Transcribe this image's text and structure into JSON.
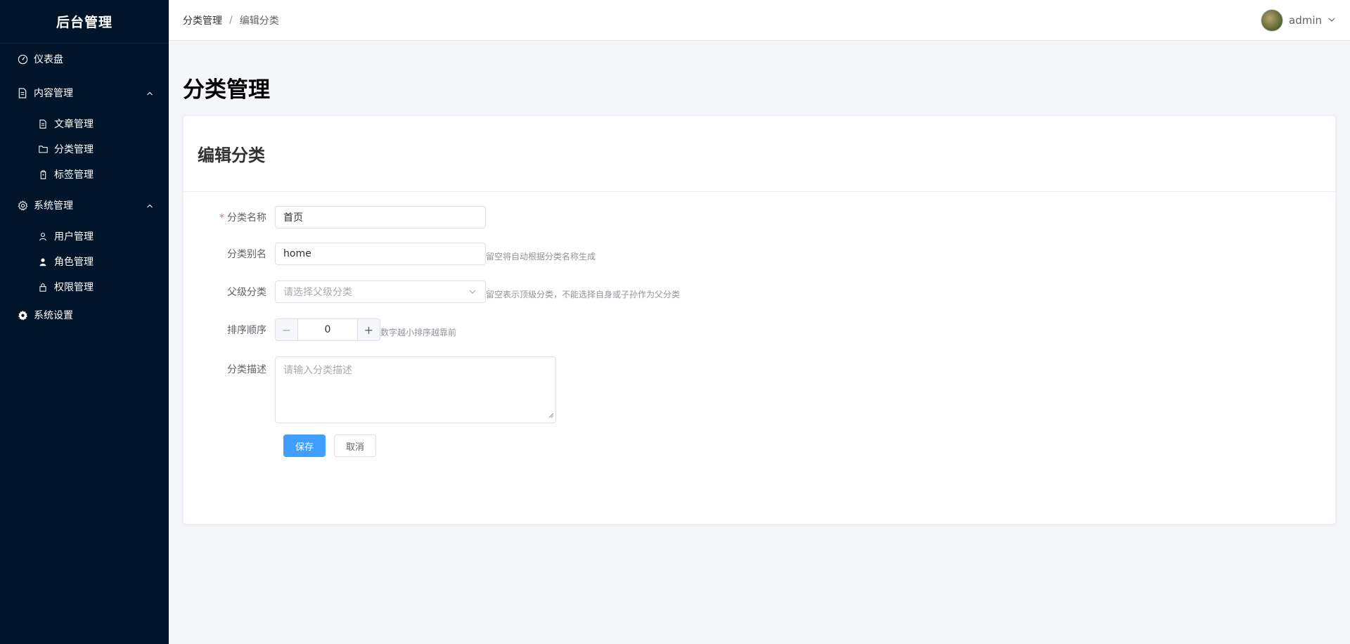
{
  "app": {
    "title": "后台管理"
  },
  "sidebar": {
    "dashboard": "仪表盘",
    "content_group": "内容管理",
    "content_items": [
      "文章管理",
      "分类管理",
      "标签管理"
    ],
    "system_group": "系统管理",
    "system_items": [
      "用户管理",
      "角色管理",
      "权限管理"
    ],
    "settings": "系统设置"
  },
  "header": {
    "breadcrumb": [
      "分类管理",
      "编辑分类"
    ],
    "separator": "/",
    "username": "admin"
  },
  "main": {
    "page_title": "分类管理",
    "card_title": "编辑分类",
    "form": {
      "name_label": "分类名称",
      "name_required_mark": "*",
      "name_value": "首页",
      "alias_label": "分类别名",
      "alias_value": "home",
      "alias_hint": "留空将自动根据分类名称生成",
      "parent_label": "父级分类",
      "parent_placeholder": "请选择父级分类",
      "parent_hint": "留空表示顶级分类，不能选择自身或子孙作为父分类",
      "sort_label": "排序顺序",
      "sort_value": "0",
      "sort_minus": "−",
      "sort_plus": "+",
      "sort_hint": "数字越小排序越靠前",
      "desc_label": "分类描述",
      "desc_placeholder": "请输入分类描述",
      "save_label": "保存",
      "cancel_label": "取消"
    }
  },
  "colors": {
    "sidebar_bg": "#001529",
    "primary": "#409eff",
    "required": "#f56c6c"
  }
}
